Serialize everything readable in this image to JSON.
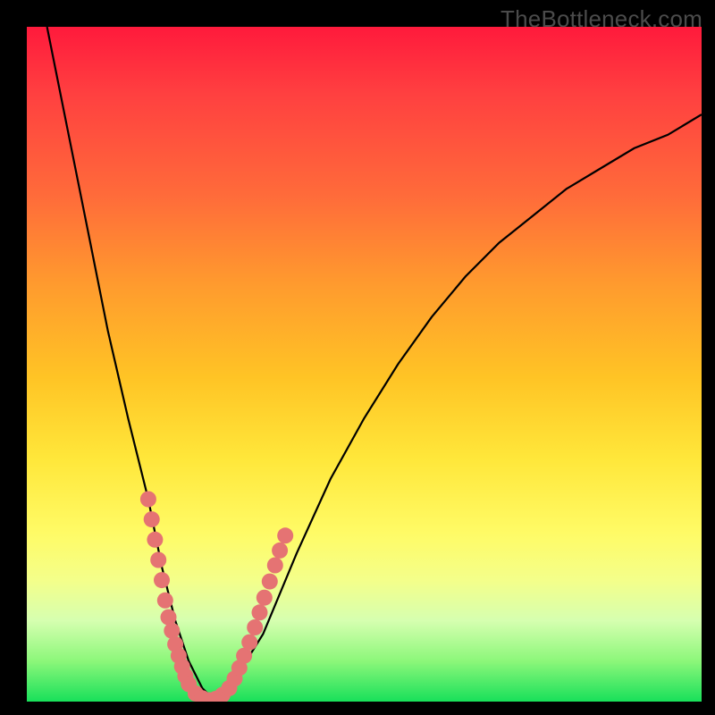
{
  "watermark": {
    "text": "TheBottleneck.com"
  },
  "chart_data": {
    "type": "line",
    "title": "",
    "xlabel": "",
    "ylabel": "",
    "xlim": [
      0,
      100
    ],
    "ylim": [
      0,
      100
    ],
    "grid": false,
    "legend": false,
    "series": [
      {
        "name": "bottleneck-curve",
        "x": [
          3,
          6,
          9,
          12,
          15,
          18,
          20,
          22,
          24,
          26,
          28,
          30,
          35,
          40,
          45,
          50,
          55,
          60,
          65,
          70,
          75,
          80,
          85,
          90,
          95,
          100
        ],
        "y": [
          100,
          85,
          70,
          55,
          42,
          30,
          20,
          12,
          6,
          2,
          0,
          2,
          10,
          22,
          33,
          42,
          50,
          57,
          63,
          68,
          72,
          76,
          79,
          82,
          84,
          87
        ]
      }
    ],
    "markers": [
      {
        "name": "dots-left-branch",
        "color": "#e57373",
        "points": [
          {
            "x": 18.0,
            "y": 30
          },
          {
            "x": 18.5,
            "y": 27
          },
          {
            "x": 19.0,
            "y": 24
          },
          {
            "x": 19.5,
            "y": 21
          },
          {
            "x": 20.0,
            "y": 18
          },
          {
            "x": 20.5,
            "y": 15
          },
          {
            "x": 21.0,
            "y": 12.5
          },
          {
            "x": 21.5,
            "y": 10.5
          },
          {
            "x": 22.0,
            "y": 8.5
          },
          {
            "x": 22.5,
            "y": 6.8
          },
          {
            "x": 23.0,
            "y": 5.2
          },
          {
            "x": 23.5,
            "y": 3.8
          },
          {
            "x": 24.0,
            "y": 2.6
          }
        ]
      },
      {
        "name": "dots-valley",
        "color": "#e57373",
        "points": [
          {
            "x": 25.0,
            "y": 1.2
          },
          {
            "x": 26.0,
            "y": 0.5
          },
          {
            "x": 27.0,
            "y": 0.2
          },
          {
            "x": 28.0,
            "y": 0.4
          },
          {
            "x": 29.0,
            "y": 1.0
          }
        ]
      },
      {
        "name": "dots-right-branch",
        "color": "#e57373",
        "points": [
          {
            "x": 30.0,
            "y": 2.0
          },
          {
            "x": 30.8,
            "y": 3.4
          },
          {
            "x": 31.5,
            "y": 5.0
          },
          {
            "x": 32.2,
            "y": 6.8
          },
          {
            "x": 33.0,
            "y": 8.8
          },
          {
            "x": 33.8,
            "y": 11.0
          },
          {
            "x": 34.5,
            "y": 13.2
          },
          {
            "x": 35.2,
            "y": 15.4
          },
          {
            "x": 36.0,
            "y": 17.8
          },
          {
            "x": 36.8,
            "y": 20.2
          },
          {
            "x": 37.5,
            "y": 22.4
          },
          {
            "x": 38.3,
            "y": 24.6
          }
        ]
      }
    ],
    "background_gradient": {
      "top": "#ff1a3c",
      "mid": "#ffe73a",
      "bottom": "#18e05a"
    }
  }
}
